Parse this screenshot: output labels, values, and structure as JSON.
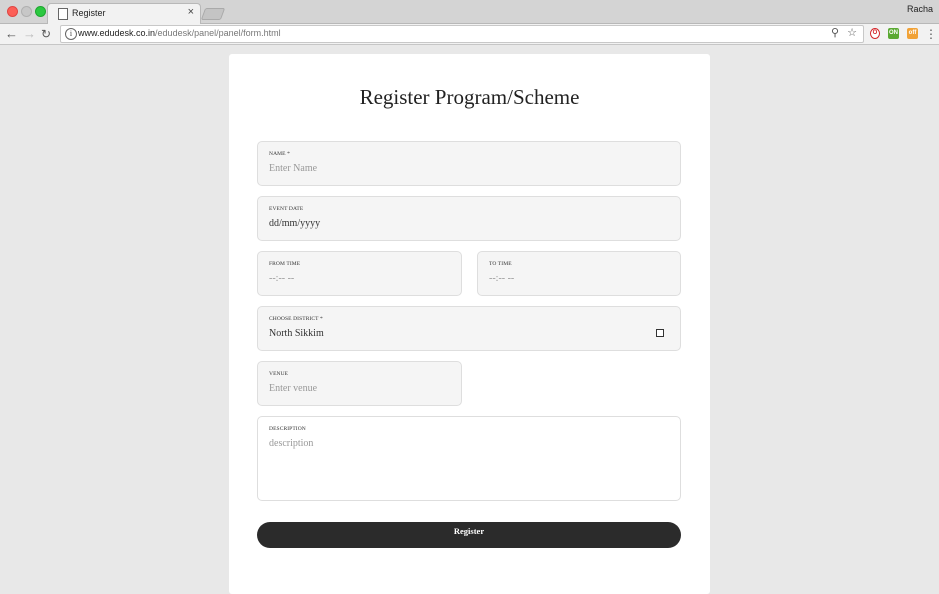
{
  "browser": {
    "tab_title": "Register",
    "tab_close": "×",
    "profile_name": "Racha",
    "url_host": "www.edudesk.co.in",
    "url_path": "/edudesk/panel/panel/form.html",
    "info_glyph": "i",
    "extensions": [
      {
        "name": "opera-icon",
        "label": "O"
      },
      {
        "name": "green-extension-icon",
        "label": "ON"
      },
      {
        "name": "orange-extension-icon",
        "label": "off"
      }
    ]
  },
  "form": {
    "title": "Register Program/Scheme",
    "fields": {
      "name": {
        "label": "NAME *",
        "placeholder": "Enter Name"
      },
      "event_date": {
        "label": "EVENT DATE",
        "value": "dd/mm/yyyy"
      },
      "from_time": {
        "label": "FROM TIME",
        "value": "--:-- --"
      },
      "to_time": {
        "label": "TO TIME",
        "value": "--:-- --"
      },
      "district": {
        "label": "CHOOSE DISTRICT *",
        "value": "North Sikkim"
      },
      "venue": {
        "label": "VENUE",
        "placeholder": "Enter venue"
      },
      "description": {
        "label": "DESCRIPTION",
        "placeholder": "description"
      }
    },
    "submit_label": "Register"
  }
}
